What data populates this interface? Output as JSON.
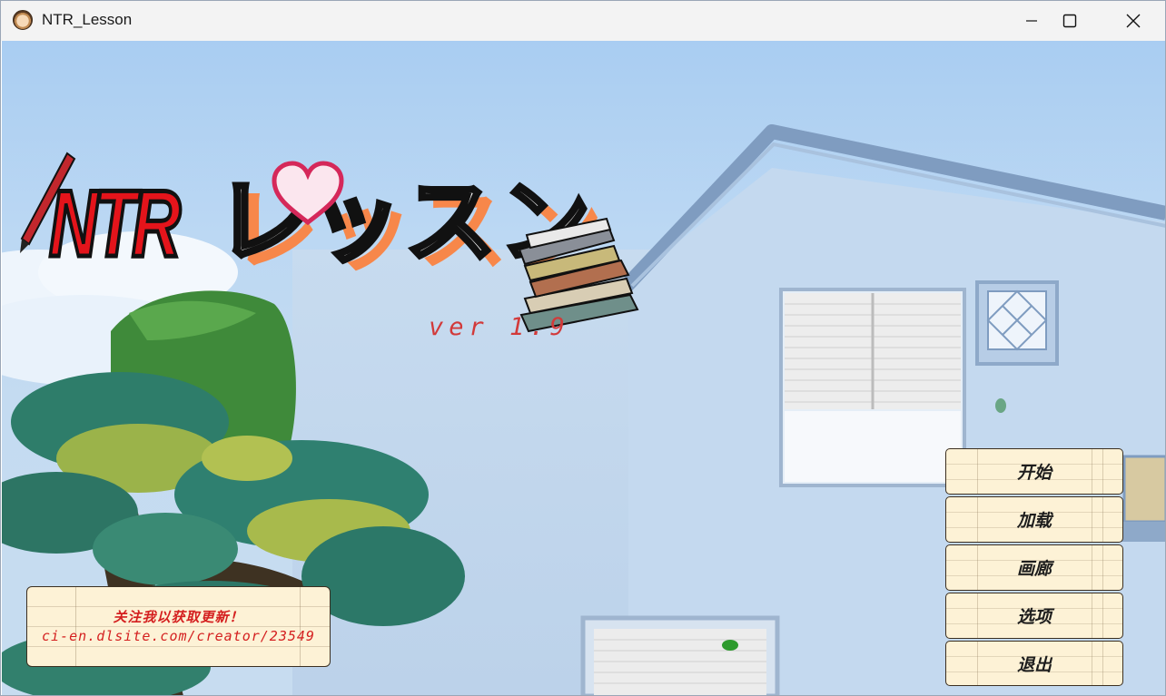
{
  "window": {
    "title": "NTR_Lesson",
    "icon": "app-portrait-icon",
    "controls": [
      "minimize-icon",
      "maximize-icon",
      "close-icon"
    ]
  },
  "logo": {
    "latin": "NTR",
    "kana": "レッスン",
    "version": "ver 1.9"
  },
  "menu": {
    "items": [
      {
        "label": "开始"
      },
      {
        "label": "加载"
      },
      {
        "label": "画廊"
      },
      {
        "label": "选项"
      },
      {
        "label": "退出"
      }
    ]
  },
  "note": {
    "line1": "关注我以获取更新！",
    "line2": "ci-en.dlsite.com/creator/23549"
  },
  "colors": {
    "sky": "#a9cdf2",
    "house": "#c4d8ee",
    "button_bg": "#fdf2d6",
    "logo_red": "#e4141b",
    "note_text": "#d41f1f"
  }
}
